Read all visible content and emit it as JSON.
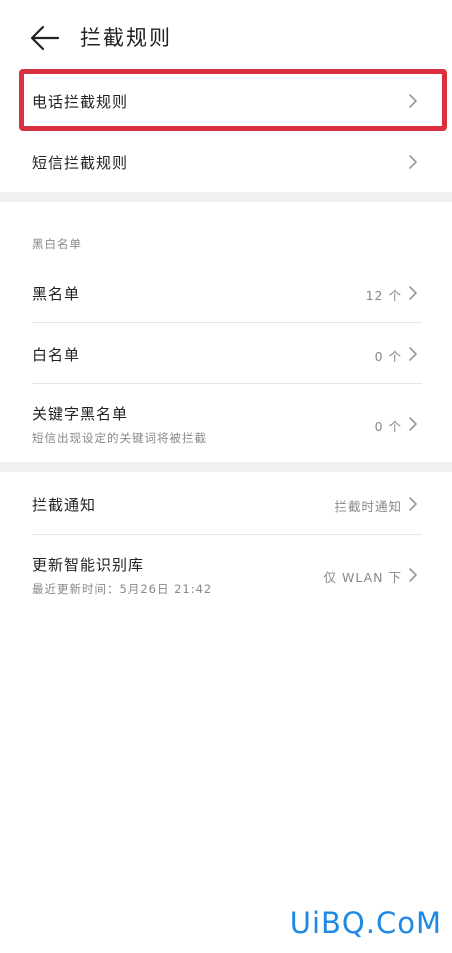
{
  "header": {
    "title": "拦截规则"
  },
  "rules": {
    "call_rules_label": "电话拦截规则",
    "sms_rules_label": "短信拦截规则"
  },
  "lists": {
    "section_title": "黑白名单",
    "blacklist_label": "黑名单",
    "blacklist_count": "12 个",
    "whitelist_label": "白名单",
    "whitelist_count": "0 个",
    "keyword_label": "关键字黑名单",
    "keyword_sub": "短信出现设定的关键词将被拦截",
    "keyword_count": "0 个"
  },
  "misc": {
    "notify_label": "拦截通知",
    "notify_value": "拦截时通知",
    "update_label": "更新智能识别库",
    "update_sub": "最近更新时间：5月26日 21:42",
    "update_value": "仅 WLAN 下"
  },
  "watermark": "UiBQ.CoM",
  "colors": {
    "highlight": "#d9313f",
    "watermark": "#1e88e5"
  }
}
